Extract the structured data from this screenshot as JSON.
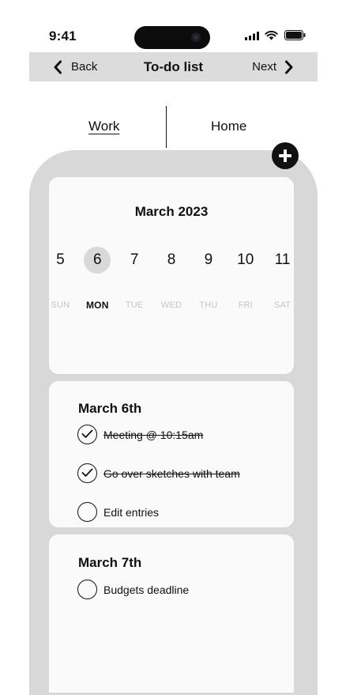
{
  "status_bar": {
    "time": "9:41"
  },
  "nav": {
    "back_label": "Back",
    "title": "To-do list",
    "next_label": "Next"
  },
  "tabs": [
    {
      "label": "Work",
      "active": true
    },
    {
      "label": "Home",
      "active": false
    }
  ],
  "calendar": {
    "month": "March 2023",
    "dates": [
      "5",
      "6",
      "7",
      "8",
      "9",
      "10",
      "11"
    ],
    "weekdays": [
      "SUN",
      "MON",
      "TUE",
      "WED",
      "THU",
      "FRI",
      "SAT"
    ],
    "selected_index": 1
  },
  "days": [
    {
      "heading": "March 6th",
      "tasks": [
        {
          "label": "Meeting @ 10:15am",
          "done": true
        },
        {
          "label": "Go over sketches with team",
          "done": true
        },
        {
          "label": "Edit entries",
          "done": false
        }
      ]
    },
    {
      "heading": "March 7th",
      "tasks": [
        {
          "label": "Budgets deadline",
          "done": false
        }
      ]
    }
  ],
  "icons": {
    "back": "chevron-left-icon",
    "next": "chevron-right-icon",
    "add": "plus-circle-icon",
    "signal": "signal-icon",
    "wifi": "wifi-icon",
    "battery": "battery-icon",
    "check": "checkmark-icon"
  }
}
